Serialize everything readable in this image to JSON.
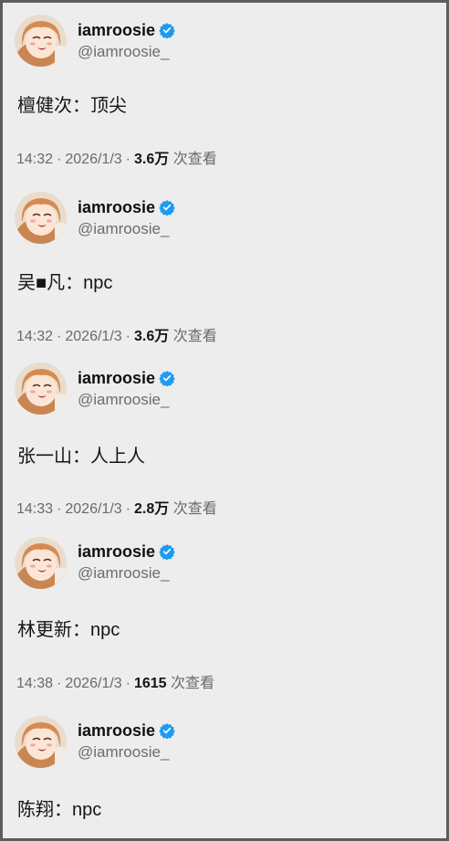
{
  "posts": [
    {
      "display_name": "iamroosie",
      "handle": "@iamroosie_",
      "text": "檀健次：顶尖",
      "time": "14:32",
      "date": "2026/1/3",
      "views": "3.6万",
      "views_label": "次查看"
    },
    {
      "display_name": "iamroosie",
      "handle": "@iamroosie_",
      "text": "吴■凡：npc",
      "time": "14:32",
      "date": "2026/1/3",
      "views": "3.6万",
      "views_label": "次查看"
    },
    {
      "display_name": "iamroosie",
      "handle": "@iamroosie_",
      "text": "张一山：人上人",
      "time": "14:33",
      "date": "2026/1/3",
      "views": "2.8万",
      "views_label": "次查看"
    },
    {
      "display_name": "iamroosie",
      "handle": "@iamroosie_",
      "text": "林更新：npc",
      "time": "14:38",
      "date": "2026/1/3",
      "views": "1615",
      "views_label": "次查看"
    },
    {
      "display_name": "iamroosie",
      "handle": "@iamroosie_",
      "text": "陈翔：npc"
    }
  ],
  "colors": {
    "background": "#ededed",
    "frame": "#5c5c5c",
    "verified": "#1d9bf0",
    "handle": "#6c6c6c"
  },
  "icons": {
    "verified": "verified-badge-icon",
    "avatar": "anime-girl-avatar"
  }
}
